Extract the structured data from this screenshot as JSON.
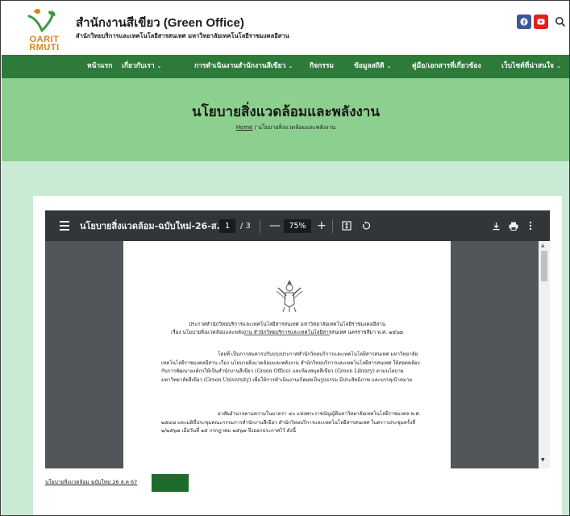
{
  "header": {
    "logo_line1": "OARIT",
    "logo_line2": "RMUTI",
    "site_title": "สำนักงานสีเขียว (Green Office)",
    "site_subtitle": "สำนักวิทยบริการและเทคโนโลยีสารสนเทศ มหาวิทยาลัยเทคโนโลยีราชมงคลอีสาน",
    "social_icons": [
      "facebook-icon",
      "youtube-icon"
    ],
    "search_icon": "search-icon"
  },
  "nav": {
    "items": [
      {
        "label": "หน้าแรก",
        "has_dropdown": false
      },
      {
        "label": "เกี่ยวกับเรา",
        "has_dropdown": true
      },
      {
        "label": "การดำเนินงานสำนักงานสีเขียว",
        "has_dropdown": true
      },
      {
        "label": "กิจกรรม",
        "has_dropdown": false
      },
      {
        "label": "ข้อมูลสถิติ",
        "has_dropdown": true
      },
      {
        "label": "คู่มือ/เอกสารที่เกี่ยวข้อง",
        "has_dropdown": false
      },
      {
        "label": "เว็บไซต์ที่น่าสนใจ",
        "has_dropdown": true
      }
    ],
    "chevron": "⌄"
  },
  "hero": {
    "title": "นโยบายสิ่งแวดล้อมและพลังงาน",
    "breadcrumb_home": "Home",
    "breadcrumb_sep": " / ",
    "breadcrumb_current": "นโยบายสิ่งแวดล้อมและพลังงาน"
  },
  "viewer": {
    "document_title": "นโยบายสิ่งแวดล้อม-ฉบับใหม่-26-ส...",
    "current_page": "1",
    "page_total": "/ 3",
    "zoom_out": "—",
    "zoom_level": "75%",
    "zoom_in": "+"
  },
  "pdf_page": {
    "heading_line1": "ประกาศสำนักวิทยบริการและเทคโนโลยีสารสนเทศ มหาวิทยาลัยเทคโนโลยีราชมงคลอีสาน",
    "heading_line2": "เรื่อง นโยบายสิ่งแวดล้อมและพลังงาน สำนักวิทยบริการและเทคโนโลยีสารสนเทศ นครราชสีมา พ.ศ. ๒๕๖๗",
    "para1": "โดยที่ เป็นการสมควรปรับปรุงประกาศสำนักวิทยบริการและเทคโนโลยีสารสนเทศ มหาวิทยาลัยเทคโนโลยีราชมงคลอีสาน เรื่อง นโยบายสิ่งแวดล้อมและพลังงาน สำนักวิทยบริการและเทคโนโลยีสารสนเทศ ให้สอดคล้องกับการพัฒนาองค์กรให้เป็นสำนักงานสีเขียว (Green Office) และห้องสมุดสีเขียว (Green Library) ตามนโยบายมหาวิทยาลัยสีเขียว (Green University) เพื่อให้การดำเนินงานเกิดผลเป็นรูปธรรม มีประสิทธิภาพ และบรรลุเป้าหมาย",
    "para2": "อาศัยอำนาจตามความในมาตรา ๔๐ แห่งพระราชบัญญัติมหาวิทยาลัยเทคโนโลยีราชมงคล พ.ศ. ๒๕๔๘ และมติที่ประชุมคณะกรรมการสำนักงานสีเขียว สำนักวิทยบริการและเทคโนโลยีสารสนเทศ ในคราวประชุมครั้งที่ ๒/๒๕๖๗ เมื่อวันที่ ๑๕ กรกฎาคม ๒๕๖๗ จึงออกประกาศไว้ ดังนี้"
  },
  "footer": {
    "file_link": "นโยบายสิ่งแวดล้อม ฉบับใหม่ 26 ส.ค 67",
    "download_label": ""
  },
  "colors": {
    "nav_green": "#2d7a3a",
    "hero_green": "#8ccf8e",
    "content_bg": "#c9ebd3",
    "button_green": "#1e6b2c",
    "viewer_toolbar": "#323639",
    "viewer_bg": "#525659",
    "facebook_blue": "#3b5998",
    "youtube_red": "#e0201c"
  }
}
